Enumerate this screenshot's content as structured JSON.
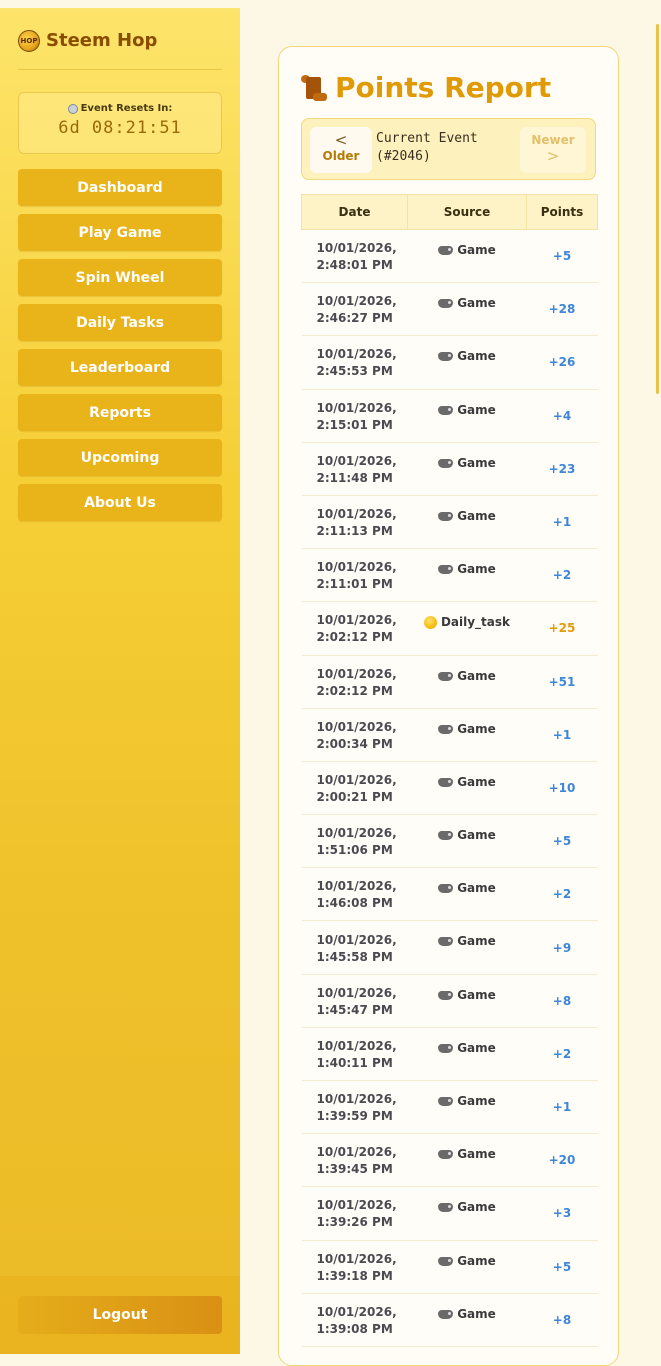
{
  "brand": {
    "name": "Steem Hop",
    "logo_text": "HOP"
  },
  "timer": {
    "label": "Event Resets In:",
    "value": "6d 08:21:51"
  },
  "nav": [
    {
      "label": "Dashboard"
    },
    {
      "label": "Play Game"
    },
    {
      "label": "Spin Wheel"
    },
    {
      "label": "Daily Tasks"
    },
    {
      "label": "Leaderboard"
    },
    {
      "label": "Reports"
    },
    {
      "label": "Upcoming"
    },
    {
      "label": "About Us"
    }
  ],
  "logout": {
    "label": "Logout"
  },
  "report": {
    "title": "Points Report",
    "pager": {
      "older_label": "Older",
      "newer_label": "Newer",
      "current_line1": "Current Event",
      "current_line2": "(#2046)"
    },
    "columns": [
      "Date",
      "Source",
      "Points"
    ],
    "rows": [
      {
        "date": "10/01/2026,",
        "time": "2:48:01 PM",
        "source": "Game",
        "points": "+5"
      },
      {
        "date": "10/01/2026,",
        "time": "2:46:27 PM",
        "source": "Game",
        "points": "+28"
      },
      {
        "date": "10/01/2026,",
        "time": "2:45:53 PM",
        "source": "Game",
        "points": "+26"
      },
      {
        "date": "10/01/2026,",
        "time": "2:15:01 PM",
        "source": "Game",
        "points": "+4"
      },
      {
        "date": "10/01/2026,",
        "time": "2:11:48 PM",
        "source": "Game",
        "points": "+23"
      },
      {
        "date": "10/01/2026,",
        "time": "2:11:13 PM",
        "source": "Game",
        "points": "+1"
      },
      {
        "date": "10/01/2026,",
        "time": "2:11:01 PM",
        "source": "Game",
        "points": "+2"
      },
      {
        "date": "10/01/2026,",
        "time": "2:02:12 PM",
        "source": "Daily_task",
        "points": "+25"
      },
      {
        "date": "10/01/2026,",
        "time": "2:02:12 PM",
        "source": "Game",
        "points": "+51"
      },
      {
        "date": "10/01/2026,",
        "time": "2:00:34 PM",
        "source": "Game",
        "points": "+1"
      },
      {
        "date": "10/01/2026,",
        "time": "2:00:21 PM",
        "source": "Game",
        "points": "+10"
      },
      {
        "date": "10/01/2026,",
        "time": "1:51:06 PM",
        "source": "Game",
        "points": "+5"
      },
      {
        "date": "10/01/2026,",
        "time": "1:46:08 PM",
        "source": "Game",
        "points": "+2"
      },
      {
        "date": "10/01/2026,",
        "time": "1:45:58 PM",
        "source": "Game",
        "points": "+9"
      },
      {
        "date": "10/01/2026,",
        "time": "1:45:47 PM",
        "source": "Game",
        "points": "+8"
      },
      {
        "date": "10/01/2026,",
        "time": "1:40:11 PM",
        "source": "Game",
        "points": "+2"
      },
      {
        "date": "10/01/2026,",
        "time": "1:39:59 PM",
        "source": "Game",
        "points": "+1"
      },
      {
        "date": "10/01/2026,",
        "time": "1:39:45 PM",
        "source": "Game",
        "points": "+20"
      },
      {
        "date": "10/01/2026,",
        "time": "1:39:26 PM",
        "source": "Game",
        "points": "+3"
      },
      {
        "date": "10/01/2026,",
        "time": "1:39:18 PM",
        "source": "Game",
        "points": "+5"
      },
      {
        "date": "10/01/2026,",
        "time": "1:39:08 PM",
        "source": "Game",
        "points": "+8"
      }
    ]
  },
  "colors": {
    "accent": "#e09a06",
    "points_blue": "#3f86d8",
    "points_gold": "#e39a06",
    "nav_button": "#e9b31a"
  }
}
